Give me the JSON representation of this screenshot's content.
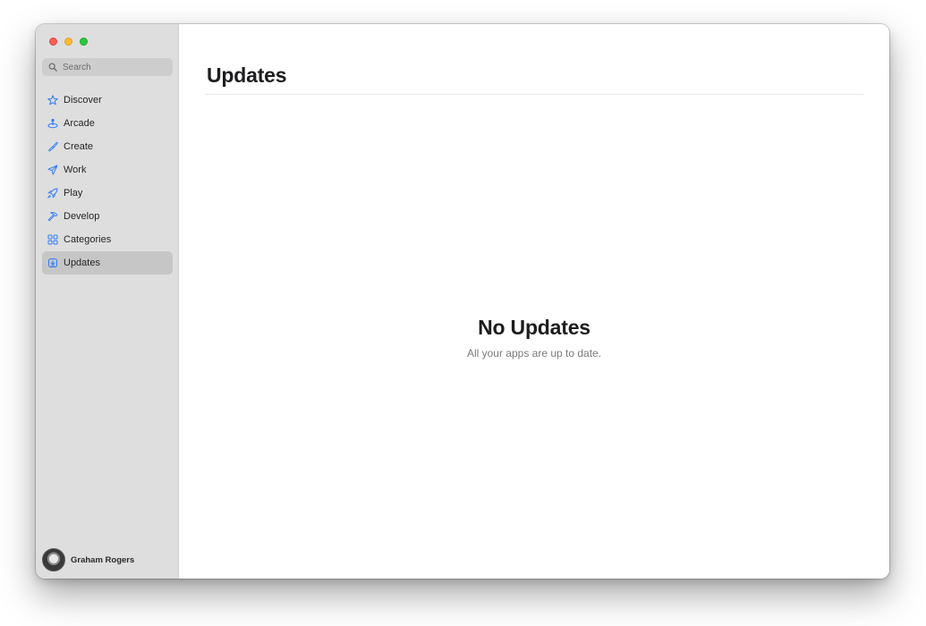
{
  "window": {
    "controls": [
      "close",
      "minimize",
      "zoom"
    ]
  },
  "sidebar": {
    "search": {
      "placeholder": "Search",
      "icon": "magnifier-icon"
    },
    "items": [
      {
        "label": "Discover",
        "icon": "star-icon",
        "active": false
      },
      {
        "label": "Arcade",
        "icon": "joystick-icon",
        "active": false
      },
      {
        "label": "Create",
        "icon": "paintbrush-icon",
        "active": false
      },
      {
        "label": "Work",
        "icon": "paperplane-icon",
        "active": false
      },
      {
        "label": "Play",
        "icon": "rocket-icon",
        "active": false
      },
      {
        "label": "Develop",
        "icon": "hammer-icon",
        "active": false
      },
      {
        "label": "Categories",
        "icon": "grid-icon",
        "active": false
      },
      {
        "label": "Updates",
        "icon": "download-icon",
        "active": true
      }
    ],
    "account": {
      "name": "Graham Rogers"
    }
  },
  "main": {
    "title": "Updates",
    "empty_state": {
      "title": "No Updates",
      "subtitle": "All your apps are up to date."
    }
  },
  "colors": {
    "accent": "#2f7cf6",
    "sidebar_bg": "#dedede",
    "active_item_bg": "#c6c6c6"
  }
}
